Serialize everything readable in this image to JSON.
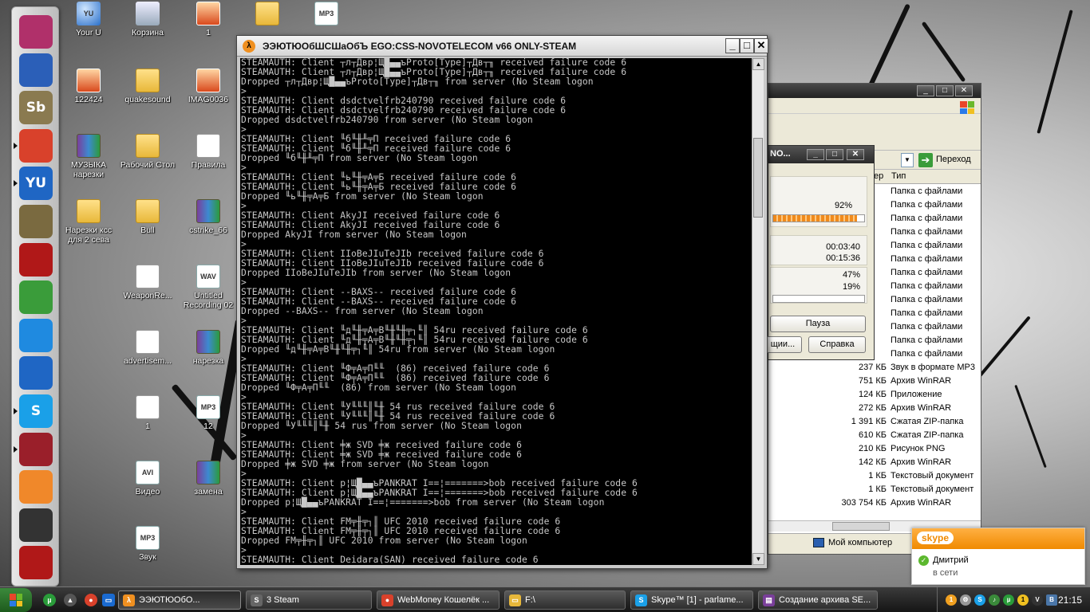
{
  "desktop": {
    "icons": [
      {
        "label": "Your U",
        "kind": "g-round",
        "glyph": "YU"
      },
      {
        "label": "Корзина",
        "kind": "g-trash",
        "glyph": ""
      },
      {
        "label": "1",
        "kind": "g-image",
        "glyph": ""
      },
      {
        "label": "",
        "kind": "g-folder",
        "glyph": ""
      },
      {
        "label": "",
        "kind": "g-mp3",
        "glyph": "MP3"
      },
      {
        "label": "122424",
        "kind": "g-image",
        "glyph": ""
      },
      {
        "label": "quakesound",
        "kind": "g-folder",
        "glyph": ""
      },
      {
        "label": "IMAG0036",
        "kind": "g-image",
        "glyph": ""
      },
      {
        "label": "МУЗЫКА нарезки",
        "kind": "g-rar",
        "glyph": ""
      },
      {
        "label": "Рабочий Стол",
        "kind": "g-folder",
        "glyph": ""
      },
      {
        "label": "Правила",
        "kind": "g-doc",
        "glyph": ""
      },
      {
        "label": "Нарезки ксс для 2 сева",
        "kind": "g-folder",
        "glyph": ""
      },
      {
        "label": "Bull",
        "kind": "g-folder",
        "glyph": ""
      },
      {
        "label": "cstrike_66",
        "kind": "g-rar",
        "glyph": ""
      },
      {
        "label": "WeaponRe...",
        "kind": "g-doc",
        "glyph": ""
      },
      {
        "label": "Untitled Recording 02",
        "kind": "g-mp3",
        "glyph": "WAV"
      },
      {
        "label": "advertisem...",
        "kind": "g-doc",
        "glyph": ""
      },
      {
        "label": "нарезка",
        "kind": "g-rar",
        "glyph": ""
      },
      {
        "label": "1",
        "kind": "g-doc",
        "glyph": ""
      },
      {
        "label": "12",
        "kind": "g-mp3",
        "glyph": "MP3"
      },
      {
        "label": "Видео",
        "kind": "g-mp3",
        "glyph": "AVI"
      },
      {
        "label": "замена",
        "kind": "g-rar",
        "glyph": ""
      },
      {
        "label": "Звук",
        "kind": "g-mp3",
        "glyph": "MP3"
      }
    ]
  },
  "dock": {
    "items": [
      {
        "icon": "monitor-icon",
        "text": "",
        "color": "#b0306a"
      },
      {
        "icon": "feather-icon",
        "text": "",
        "color": "#2b5fb8"
      },
      {
        "icon": "sb-icon",
        "text": "Sb",
        "color": "#8a7a50"
      },
      {
        "icon": "chrome-icon",
        "text": "",
        "color": "#d9412b"
      },
      {
        "icon": "yu-icon",
        "text": "YU",
        "color": "#1f66c4"
      },
      {
        "icon": "temple-icon",
        "text": "",
        "color": "#7a6a40"
      },
      {
        "icon": "disc-icon",
        "text": "",
        "color": "#b01818"
      },
      {
        "icon": "sims-icon",
        "text": "",
        "color": "#3a9c3a"
      },
      {
        "icon": "player-icon",
        "text": "",
        "color": "#1f8ae0"
      },
      {
        "icon": "teamviewer-icon",
        "text": "",
        "color": "#1f66c4"
      },
      {
        "icon": "skype-icon",
        "text": "S",
        "color": "#1aa0e8"
      },
      {
        "icon": "steam-icon",
        "text": "",
        "color": "#9a1f2a"
      },
      {
        "icon": "game-icon",
        "text": "",
        "color": "#f0882a"
      },
      {
        "icon": "aorg-icon",
        "text": "",
        "color": "#333333"
      },
      {
        "icon": "trash-icon",
        "text": "",
        "color": "#b01818"
      }
    ]
  },
  "console": {
    "title": "ЭЭЮТЮОбШСШаОбЪ EGO:CSS-NOVOTELECOM v66 ONLY-STEAM",
    "lines": [
      "STEAMAUTH: Client ┬л┬Двр¦Щ█▄▄ъProto[Type]┬Дв┬╖ received failure code 6",
      "STEAMAUTH: Client ┬л┬Двр¦Щ█▄▄ъProto[Type]┬Дв┬╖ received failure code 6",
      "Dropped ┬л┬Двр¦Щ█▄▄ъProto[Type]┬Дв┬╖ from server (No Steam logon",
      ">",
      "STEAMAUTH: Client dsdctvelfrb240790 received failure code 6",
      "STEAMAUTH: Client dsdctvelfrb240790 received failure code 6",
      "Dropped dsdctvelfrb240790 from server (No Steam logon",
      ">",
      "STEAMAUTH: Client ╙б╙╫╨╤П received failure code 6",
      "STEAMAUTH: Client ╙б╙╫╨╤П received failure code 6",
      "Dropped ╙б╙╫╨╤П from server (No Steam logon",
      ">",
      "STEAMAUTH: Client ╙ь╙╫╤А╤Б received failure code 6",
      "STEAMAUTH: Client ╙ь╙╫╤А╤Б received failure code 6",
      "Dropped ╙ь╙╫╤А╤Б from server (No Steam logon",
      ">",
      "STEAMAUTH: Client AkyJI received failure code 6",
      "STEAMAUTH: Client AkyJI received failure code 6",
      "Dropped AkyJI from server (No Steam logon",
      ">",
      "STEAMAUTH: Client IIoBeJIuTeJIb received failure code 6",
      "STEAMAUTH: Client IIoBeJIuTeJIb received failure code 6",
      "Dropped IIoBeJIuTeJIb from server (No Steam logon",
      ">",
      "STEAMAUTH: Client --BAXS-- received failure code 6",
      "STEAMAUTH: Client --BAXS-- received failure code 6",
      "Dropped --BAXS-- from server (No Steam logon",
      ">",
      "STEAMAUTH: Client ╙д╙╫╤А╤В╙╫╙╫╤┐╙║ 54ru received failure code 6",
      "STEAMAUTH: Client ╙д╙╫╤А╤В╙╫╙╫╤┐╙║ 54ru received failure code 6",
      "Dropped ╙д╙╫╤А╤В╙╫╙╫╤┐╙║ 54ru from server (No Steam logon",
      ">",
      "STEAMAUTH: Client ╙Ф╤А╤П╙╙  (86) received failure code 6",
      "STEAMAUTH: Client ╙Ф╤А╤П╙╙  (86) received failure code 6",
      "Dropped ╙Ф╤А╤П╙╙  (86) from server (No Steam logon",
      ">",
      "STEAMAUTH: Client ╙У╙╙╙║╙╫ 54 rus received failure code 6",
      "STEAMAUTH: Client ╙У╙╙╙║╙╫ 54 rus received failure code 6",
      "Dropped ╙У╙╙╙║╙╫ 54 rus from server (No Steam logon",
      ">",
      "STEAMAUTH: Client ╪ж SVD ╪ж received failure code 6",
      "STEAMAUTH: Client ╪ж SVD ╪ж received failure code 6",
      "Dropped ╪ж SVD ╪ж from server (No Steam logon",
      ">",
      "STEAMAUTH: Client р¦Щ█▄▄ъPANKRAT I==¦=======>bob received failure code 6",
      "STEAMAUTH: Client р¦Щ█▄▄ъPANKRAT I==¦=======>bob received failure code 6",
      "Dropped р¦Щ█▄▄ъPANKRAT I==¦=======>bob from server (No Steam logon",
      ">",
      "STEAMAUTH: Client FM╤╫╤┐║ UFC 2010 received failure code 6",
      "STEAMAUTH: Client FM╤╫╤┐║ UFC 2010 received failure code 6",
      "Dropped FM╤╫╤┐║ UFC 2010 from server (No Steam logon",
      ">",
      "STEAMAUTH: Client Deidara(SAN) received failure code 6"
    ]
  },
  "explorer": {
    "go_label": "Переход",
    "col_partial": "ер",
    "col_type": "Тип",
    "rows": [
      {
        "size": "",
        "type": "Папка с файлами"
      },
      {
        "size": "",
        "type": "Папка с файлами"
      },
      {
        "size": "",
        "type": "Папка с файлами"
      },
      {
        "size": "",
        "type": "Папка с файлами"
      },
      {
        "size": "",
        "type": "Папка с файлами"
      },
      {
        "size": "",
        "type": "Папка с файлами"
      },
      {
        "size": "",
        "type": "Папка с файлами"
      },
      {
        "size": "",
        "type": "Папка с файлами"
      },
      {
        "size": "",
        "type": "Папка с файлами"
      },
      {
        "size": "",
        "type": "Папка с файлами"
      },
      {
        "size": "",
        "type": "Папка с файлами"
      },
      {
        "size": "",
        "type": "Папка с файлами"
      },
      {
        "size": "",
        "type": "Папка с файлами"
      },
      {
        "size": "237 КБ",
        "type": "Звук в формате MP3"
      },
      {
        "size": "751 КБ",
        "type": "Архив WinRAR"
      },
      {
        "size": "124 КБ",
        "type": "Приложение"
      },
      {
        "size": "272 КБ",
        "type": "Архив WinRAR"
      },
      {
        "size": "1 391 КБ",
        "type": "Сжатая ZIP-папка"
      },
      {
        "size": "610 КБ",
        "type": "Сжатая ZIP-папка"
      },
      {
        "size": "210 КБ",
        "type": "Рисунок PNG"
      },
      {
        "size": "142 КБ",
        "type": "Архив WinRAR"
      },
      {
        "size": "1 КБ",
        "type": "Текстовый документ"
      },
      {
        "size": "1 КБ",
        "type": "Текстовый документ"
      },
      {
        "size": "303 754 КБ",
        "type": "Архив WinRAR"
      }
    ],
    "status_label": "Мой компьютер"
  },
  "rar_dialog": {
    "title": "NO...",
    "progress1_text": "92%",
    "progress1_value": 92,
    "time_elapsed": "00:03:40",
    "time_left": "00:15:36",
    "ratio1": "47%",
    "ratio2": "19%",
    "pause_label": "Пауза",
    "options_label": "щии...",
    "help_label": "Справка"
  },
  "skype_popup": {
    "logo": "skype",
    "contact_name": "Дмитрий",
    "contact_status": "в сети"
  },
  "taskbar": {
    "tasks": [
      {
        "label": "ЭЭЮТЮОбО...",
        "icon": "halflife-icon",
        "color": "#f09020",
        "glyph": "λ"
      },
      {
        "label": "3 Steam",
        "icon": "steam-icon",
        "color": "#666666",
        "glyph": "S"
      },
      {
        "label": "WebMoney Кошелёк ...",
        "icon": "chrome-icon",
        "color": "#d9412b",
        "glyph": "●"
      },
      {
        "label": "F:\\",
        "icon": "folder-icon",
        "color": "#e8b83a",
        "glyph": "▭"
      },
      {
        "label": "Skype™ [1] - parlame...",
        "icon": "skype-icon",
        "color": "#1aa0e8",
        "glyph": "S"
      },
      {
        "label": "Создание архива SE...",
        "icon": "winrar-icon",
        "color": "#7a3f9a",
        "glyph": "▤"
      }
    ],
    "clock": "21:15",
    "tray_badge": "1"
  }
}
